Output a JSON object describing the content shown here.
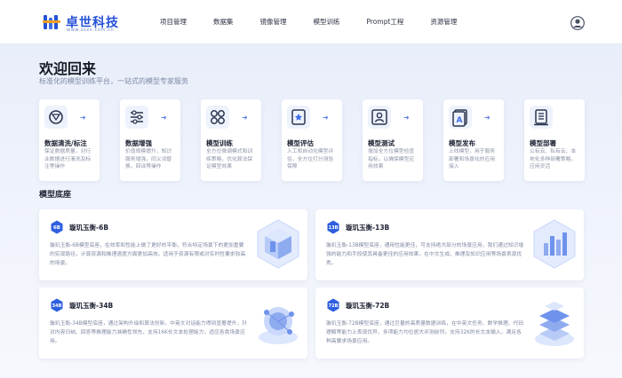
{
  "header": {
    "brand_name": "卓世科技",
    "brand_sub": "www.zsxx.com.cn",
    "nav": [
      "项目管理",
      "数据集",
      "镜像管理",
      "模型训练",
      "Prompt工程",
      "资源管理"
    ]
  },
  "welcome": {
    "title": "欢迎回来",
    "subtitle": "标准化的模型训练平台，一站式的模型专家服务"
  },
  "features": [
    {
      "title": "数据清洗/标注",
      "desc": "保证数据质量，对行业数据进行清洗及标注等操作",
      "icon": "filter-icon"
    },
    {
      "title": "数据增强",
      "desc": "价值规模提升，知识服务增强，同义词替换，回译等操作",
      "icon": "sliders-icon"
    },
    {
      "title": "模型训练",
      "desc": "全方位微调模式和训练策略，优化算法保证模型效果",
      "icon": "grid-nodes-icon"
    },
    {
      "title": "模型评估",
      "desc": "人工和自动化模型评估，全方位打分测验保障",
      "icon": "badge-star-icon"
    },
    {
      "title": "模型测试",
      "desc": "增加全方位模型检查指标，以确保模型应用效果",
      "icon": "user-frame-icon"
    },
    {
      "title": "模型发布",
      "desc": "上线模型，用于服务部署和场景化的应用接入",
      "icon": "document-a-icon"
    },
    {
      "title": "模型部署",
      "desc": "公有云、私有云、本地化多种部署策略，应用灵活",
      "icon": "list-doc-icon"
    }
  ],
  "section": {
    "title": "模型底座"
  },
  "models": [
    {
      "badge": "6B",
      "name": "璇玑玉衡-6B",
      "desc": "璇玑玉衡-6B模型底座，在效率和性能上做了更好的平衡，符合特定场景下的更加重要的实现路径，计算资源和推理速度方面更加高效。适用于资源有限或对实时性要求较高的场景。"
    },
    {
      "badge": "13B",
      "name": "璇玑玉衡-13B",
      "desc": "璇玑玉衡-13B模型底座，通用性能更佳，可支持绝大部分的场景应用，我们通过知识增强的能力和手段使其具备更佳的应用效果，在中文生成、推理及知识应用等场景表现优秀。"
    },
    {
      "badge": "34B",
      "name": "璇玑玉衡-34B",
      "desc": "璇玑玉衡-34B模型底座，通过架构升级和算法创新，中英文对话能力得到显著提升，针对内容归纳、回答等推理能力准确性领先，支持16K长文本处理能力，适应各类场景应用。"
    },
    {
      "badge": "72B",
      "name": "璇玑玉衡-72B",
      "desc": "璇玑玉衡-72B模型底座，通过巨量的高质量数据训练，在中英文任务、数学推理、代码理解等能力上表现优异，多项能力均位居大评测前列，支持32K的长文本输入，满足各种高要求场景应用。"
    }
  ],
  "colors": {
    "brand": "#2450d6",
    "accent": "#3e6ee6"
  }
}
